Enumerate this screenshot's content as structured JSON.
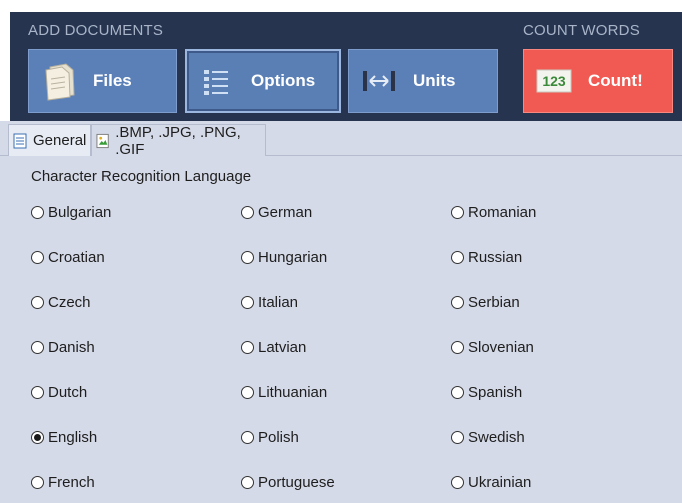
{
  "ribbon": {
    "add_documents_label": "ADD DOCUMENTS",
    "count_words_label": "COUNT WORDS",
    "files_label": "Files",
    "options_label": "Options",
    "units_label": "Units",
    "count_label": "Count!",
    "count_icon_text": "123"
  },
  "tabs": [
    {
      "label": "General"
    },
    {
      "label": ".BMP, .JPG, .PNG, .GIF"
    }
  ],
  "section_title": "Character Recognition Language",
  "languages": [
    [
      "Bulgarian",
      "German",
      "Romanian"
    ],
    [
      "Croatian",
      "Hungarian",
      "Russian"
    ],
    [
      "Czech",
      "Italian",
      "Serbian"
    ],
    [
      "Danish",
      "Latvian",
      "Slovenian"
    ],
    [
      "Dutch",
      "Lithuanian",
      "Spanish"
    ],
    [
      "English",
      "Polish",
      "Swedish"
    ],
    [
      "French",
      "Portuguese",
      "Ukrainian"
    ]
  ],
  "selected_language": "English",
  "colors": {
    "ribbon_bg": "#26344f",
    "button_blue": "#5b80b8",
    "count_red": "#f15a52",
    "panel_bg": "#d5dae8"
  }
}
